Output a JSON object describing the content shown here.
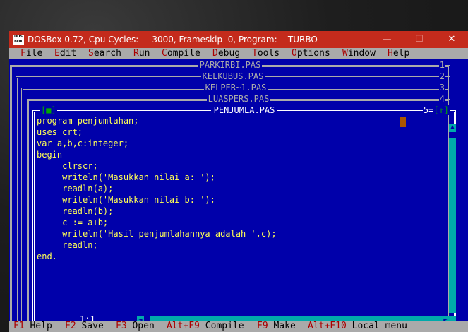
{
  "window": {
    "title": "DOSBox 0.72, Cpu Cycles:     3000, Frameskip  0, Program:    TURBO",
    "icon_text": "DOS BOX",
    "minimize_glyph": "—",
    "maximize_glyph": "☐",
    "close_glyph": "✕"
  },
  "menu": {
    "items": [
      {
        "hotkey": "F",
        "rest": "ile"
      },
      {
        "hotkey": "E",
        "rest": "dit"
      },
      {
        "hotkey": "S",
        "rest": "earch"
      },
      {
        "hotkey": "R",
        "rest": "un"
      },
      {
        "hotkey": "C",
        "rest": "ompile"
      },
      {
        "hotkey": "D",
        "rest": "ebug"
      },
      {
        "hotkey": "T",
        "rest": "ools"
      },
      {
        "hotkey": "O",
        "rest": "ptions"
      },
      {
        "hotkey": "W",
        "rest": "indow"
      },
      {
        "hotkey": "H",
        "rest": "elp"
      }
    ]
  },
  "background_windows": [
    {
      "title": "PARKIRBI.PAS",
      "number": "1"
    },
    {
      "title": "KELKUBUS.PAS",
      "number": "2"
    },
    {
      "title": "KELPER~1.PAS",
      "number": "3"
    },
    {
      "title": "LUASPERS.PAS",
      "number": "4"
    }
  ],
  "editor": {
    "title": "PENJUMLA.PAS",
    "number": "5",
    "close_box": "[■]",
    "zoom_glyph": "[↑]",
    "cursor_position": "1:1",
    "code_lines": [
      "program penjumlahan;",
      "uses crt;",
      "var a,b,c:integer;",
      "begin",
      "     clrscr;",
      "     writeln('Masukkan nilai a: ');",
      "     readln(a);",
      "     writeln('Masukkan nilai b: ');",
      "     readln(b);",
      "     c := a+b;",
      "     writeln('Hasil penjumlahannya adalah ',c);",
      "     readln;",
      "end."
    ]
  },
  "status": {
    "items": [
      {
        "key": "F1",
        "label": "Help"
      },
      {
        "key": "F2",
        "label": "Save"
      },
      {
        "key": "F3",
        "label": "Open"
      },
      {
        "key": "Alt+F9",
        "label": "Compile"
      },
      {
        "key": "F9",
        "label": "Make"
      },
      {
        "key": "Alt+F10",
        "label": "Local menu"
      }
    ]
  },
  "colors": {
    "title_bar": "#c42b1c",
    "dos_background": "#0000aa",
    "code_text": "#ffff55",
    "menu_background": "#aaaaaa",
    "hotkey": "#aa0000"
  }
}
